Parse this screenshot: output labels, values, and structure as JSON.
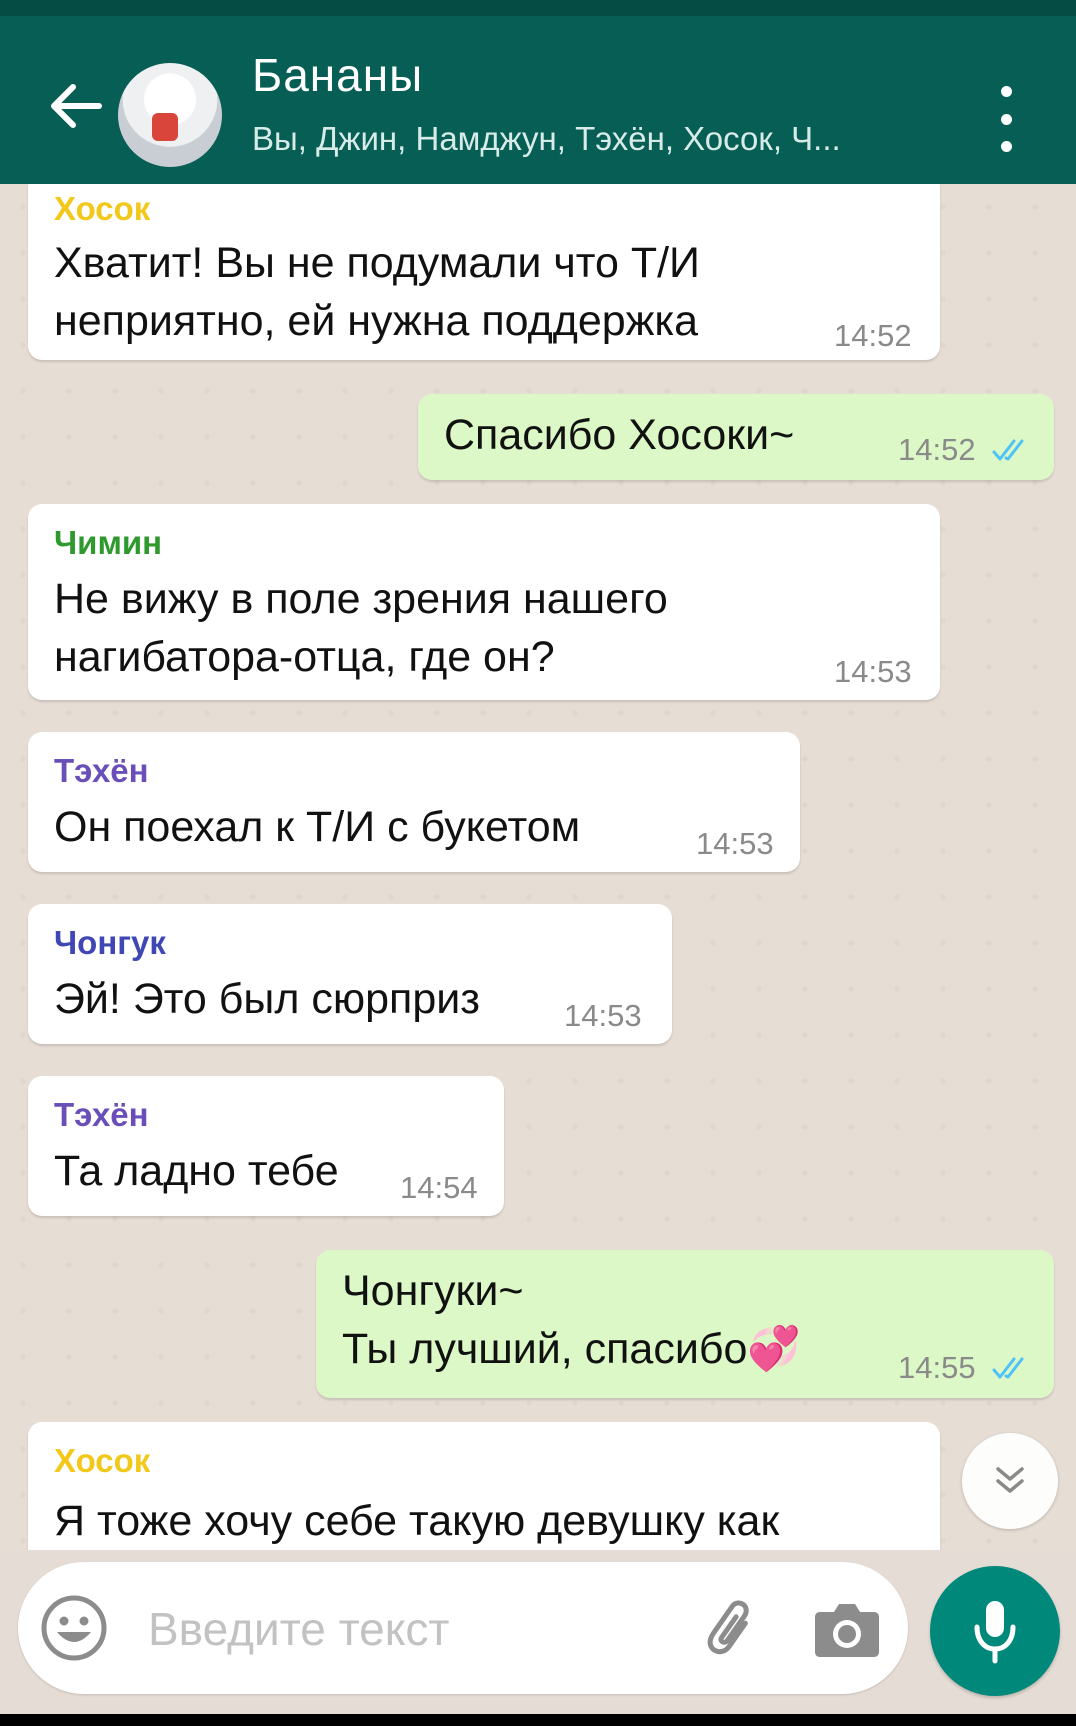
{
  "header": {
    "title": "Бананы",
    "subtitle": "Вы, Джин, Намджун, Тэхён, Хосок, Ч...",
    "back_icon": "arrow-left-icon",
    "menu_icon": "more-vert-icon"
  },
  "messages": [
    {
      "direction": "in",
      "sender": "Хосок",
      "text": [
        "Хватит! Вы не подумали что Т/И",
        "неприятно, ей нужна поддержка"
      ],
      "time": "14:52"
    },
    {
      "direction": "out",
      "text": [
        "Спасибо Хосоки~"
      ],
      "time": "14:52",
      "status": "read"
    },
    {
      "direction": "in",
      "sender": "Чимин",
      "text": [
        "Не вижу в поле зрения нашего",
        "нагибатора-отца, где он?"
      ],
      "time": "14:53"
    },
    {
      "direction": "in",
      "sender": "Тэхён",
      "text": [
        "Он поехал к Т/И с букетом"
      ],
      "time": "14:53"
    },
    {
      "direction": "in",
      "sender": "Чонгук",
      "text": [
        "Эй! Это был сюрприз"
      ],
      "time": "14:53"
    },
    {
      "direction": "in",
      "sender": "Тэхён",
      "text": [
        "Та ладно тебе"
      ],
      "time": "14:54"
    },
    {
      "direction": "out",
      "text": [
        "Чонгуки~",
        "Ты лучший, спасибо💞"
      ],
      "time": "14:55",
      "status": "read"
    },
    {
      "direction": "in",
      "sender": "Хосок",
      "text": [
        "Я тоже хочу себе такую девушку как"
      ],
      "time": ""
    }
  ],
  "colors": {
    "header": "#075e54",
    "incoming": "#ffffff",
    "outgoing": "#dcf8c6",
    "read_ticks": "#4fc3f7",
    "sender_hosok": "#f2c81b",
    "sender_jimin": "#2e9a2e",
    "sender_taehyung": "#6a4fb8",
    "sender_jungkook": "#3f47b5",
    "mic": "#00897b"
  },
  "input": {
    "placeholder": "Введите текст",
    "value": ""
  },
  "icons": {
    "emoji": "emoji-icon",
    "attach": "paperclip-icon",
    "camera": "camera-icon",
    "mic": "mic-icon",
    "scroll_down": "double-chevron-down-icon"
  }
}
